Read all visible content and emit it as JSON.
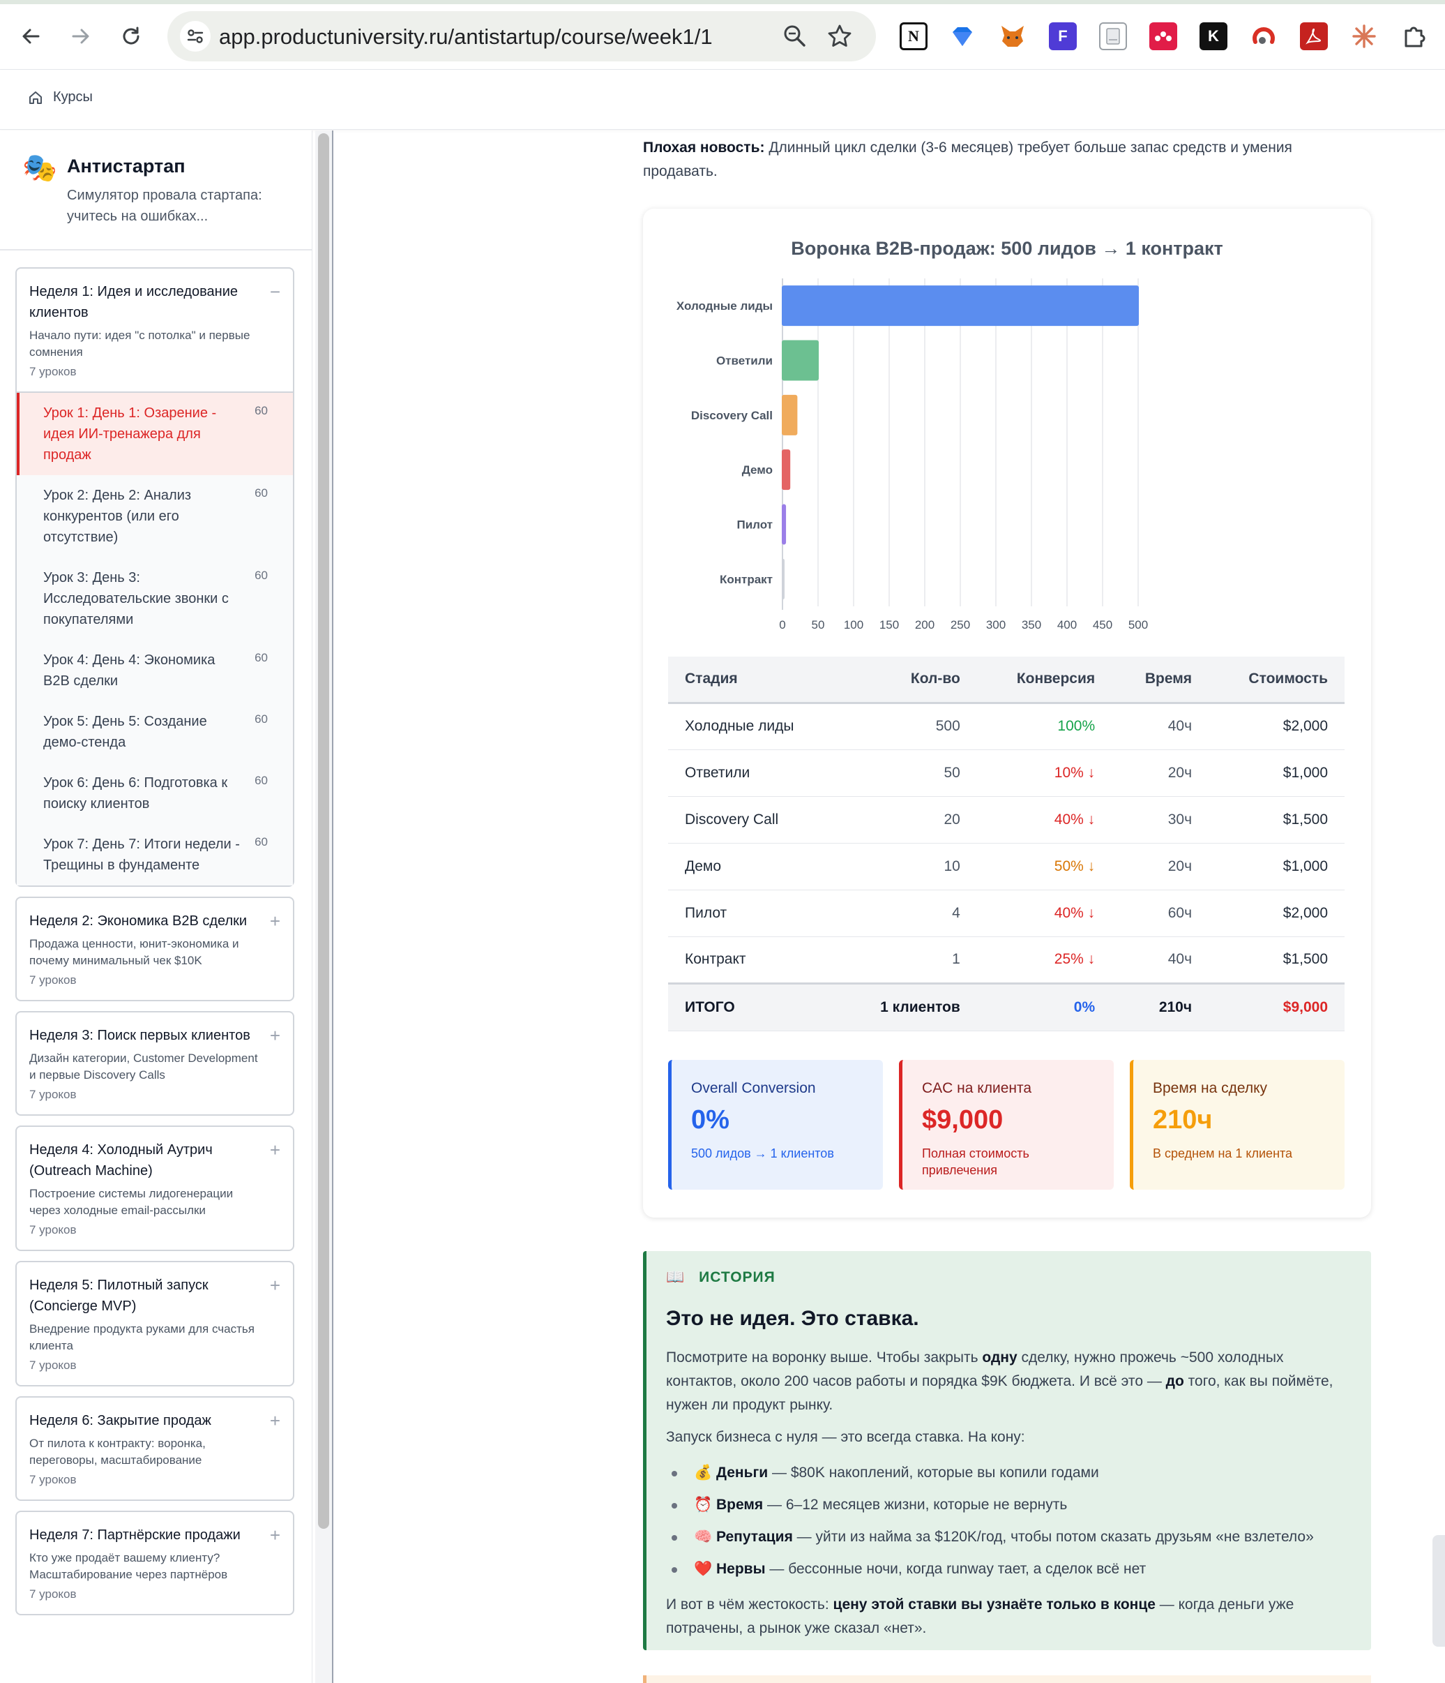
{
  "browser": {
    "url": "app.productuniversity.ru/antistartup/course/week1/1"
  },
  "breadcrumb": {
    "label": "Курсы"
  },
  "course": {
    "emoji": "🎭",
    "title": "Антистартап",
    "subtitle": "Симулятор провала стартапа: учитесь на ошибках..."
  },
  "weeks": [
    {
      "title": "Неделя 1: Идея и исследование клиентов",
      "desc": "Начало пути: идея \"с потолка\" и первые сомнения",
      "count": "7 уроков",
      "toggle": "−",
      "lessons": [
        {
          "title": "Урок 1: День 1: Озарение - идея ИИ-тренажера для продаж",
          "dur": "60",
          "active": true
        },
        {
          "title": "Урок 2: День 2: Анализ конкурентов (или его отсутствие)",
          "dur": "60"
        },
        {
          "title": "Урок 3: День 3: Исследовательские звонки с покупателями",
          "dur": "60"
        },
        {
          "title": "Урок 4: День 4: Экономика B2B сделки",
          "dur": "60"
        },
        {
          "title": "Урок 5: День 5: Создание демо-стенда",
          "dur": "60"
        },
        {
          "title": "Урок 6: День 6: Подготовка к поиску клиентов",
          "dur": "60"
        },
        {
          "title": "Урок 7: День 7: Итоги недели - Трещины в фундаменте",
          "dur": "60"
        }
      ]
    },
    {
      "title": "Неделя 2: Экономика B2B сделки",
      "desc": "Продажа ценности, юнит-экономика и почему минимальный чек $10K",
      "count": "7 уроков",
      "toggle": "+"
    },
    {
      "title": "Неделя 3: Поиск первых клиентов",
      "desc": "Дизайн категории, Customer Development и первые Discovery Calls",
      "count": "7 уроков",
      "toggle": "+"
    },
    {
      "title": "Неделя 4: Холодный Аутрич (Outreach Machine)",
      "desc": "Построение системы лидогенерации через холодные email-рассылки",
      "count": "7 уроков",
      "toggle": "+"
    },
    {
      "title": "Неделя 5: Пилотный запуск (Concierge MVP)",
      "desc": "Внедрение продукта руками для счастья клиента",
      "count": "7 уроков",
      "toggle": "+"
    },
    {
      "title": "Неделя 6: Закрытие продаж",
      "desc": "От пилота к контракту: воронка, переговоры, масштабирование",
      "count": "7 уроков",
      "toggle": "+"
    },
    {
      "title": "Неделя 7: Партнёрские продажи",
      "desc": "Кто уже продаёт вашему клиенту? Масштабирование через партнёров",
      "count": "7 уроков",
      "toggle": "+"
    }
  ],
  "content": {
    "badnews_label": "Плохая новость:",
    "badnews_text": " Длинный цикл сделки (3-6 месяцев) требует больше запас средств и умения продавать."
  },
  "chart_data": {
    "type": "bar",
    "orientation": "horizontal",
    "title": "Воронка B2B-продаж: 500 лидов → 1 контракт",
    "categories": [
      "Холодные лиды",
      "Ответили",
      "Discovery Call",
      "Демо",
      "Пилот",
      "Контракт"
    ],
    "values": [
      500,
      50,
      20,
      10,
      4,
      1
    ],
    "colors": [
      "#5b8def",
      "#6cc091",
      "#f0ab5c",
      "#e46464",
      "#9b7fe8",
      "#cfd3da"
    ],
    "xlim": [
      0,
      500
    ],
    "xticks": [
      0,
      50,
      100,
      150,
      200,
      250,
      300,
      350,
      400,
      450,
      500
    ],
    "grid": true,
    "legend": "none"
  },
  "funnel_table": {
    "headers": [
      "Стадия",
      "Кол-во",
      "Конверсия",
      "Время",
      "Стоимость"
    ],
    "rows": [
      {
        "stage": "Холодные лиды",
        "count": "500",
        "conv": "100%",
        "conv_color": "#16a34a",
        "time": "40ч",
        "cost": "$2,000"
      },
      {
        "stage": "Ответили",
        "count": "50",
        "conv": "10% ↓",
        "conv_color": "#dc2626",
        "time": "20ч",
        "cost": "$1,000"
      },
      {
        "stage": "Discovery Call",
        "count": "20",
        "conv": "40% ↓",
        "conv_color": "#dc2626",
        "time": "30ч",
        "cost": "$1,500"
      },
      {
        "stage": "Демо",
        "count": "10",
        "conv": "50% ↓",
        "conv_color": "#d97706",
        "time": "20ч",
        "cost": "$1,000"
      },
      {
        "stage": "Пилот",
        "count": "4",
        "conv": "40% ↓",
        "conv_color": "#dc2626",
        "time": "60ч",
        "cost": "$2,000"
      },
      {
        "stage": "Контракт",
        "count": "1",
        "conv": "25% ↓",
        "conv_color": "#dc2626",
        "time": "40ч",
        "cost": "$1,500"
      }
    ],
    "total": {
      "stage": "ИТОГО",
      "count": "1 клиентов",
      "conv": "0%",
      "time": "210ч",
      "cost": "$9,000"
    }
  },
  "stats": [
    {
      "label": "Overall Conversion",
      "value": "0%",
      "note": "500 лидов → 1 клиентов",
      "accent": "#2563eb",
      "bg": "#eaf1fd",
      "label_color": "#1e3a8a",
      "note_color": "#2563eb"
    },
    {
      "label": "CAC на клиента",
      "value": "$9,000",
      "note": "Полная стоимость привлечения",
      "accent": "#dc2626",
      "bg": "#fdeeee",
      "label_color": "#7f1d1d",
      "note_color": "#b91c1c"
    },
    {
      "label": "Время на сделку",
      "value": "210ч",
      "note": "В среднем на 1 клиента",
      "accent": "#f59e0b",
      "bg": "#fdf8e8",
      "label_color": "#78350f",
      "note_color": "#b45309"
    }
  ],
  "story": {
    "tag_icon": "📖",
    "tag": "ИСТОРИЯ",
    "heading": "Это не идея. Это ставка.",
    "p1_a": "Посмотрите на воронку выше. Чтобы закрыть ",
    "p1_b": "одну",
    "p1_c": " сделку, нужно прожечь ~500 холодных контактов, около 200 часов работы и порядка $9K бюджета. И всё это — ",
    "p1_d": "до",
    "p1_e": " того, как вы поймёте, нужен ли продукт рынку.",
    "p2": "Запуск бизнеса с нуля — это всегда ставка. На кону:",
    "items": [
      {
        "emoji": "💰",
        "bold": "Деньги",
        "text": " — $80K накоплений, которые вы копили годами"
      },
      {
        "emoji": "⏰",
        "bold": "Время",
        "text": " — 6–12 месяцев жизни, которые не вернуть"
      },
      {
        "emoji": "🧠",
        "bold": "Репутация",
        "text": " — уйти из найма за $120K/год, чтобы потом сказать друзьям «не взлетело»"
      },
      {
        "emoji": "❤️",
        "bold": "Нервы",
        "text": " — бессонные ночи, когда runway тает, а сделок всё нет"
      }
    ],
    "p3_a": "И вот в чём жестокость: ",
    "p3_b": "цену этой ставки вы узнаёте только в конце",
    "p3_c": " — когда деньги уже потрачены, а рынок уже сказал «нет»."
  }
}
